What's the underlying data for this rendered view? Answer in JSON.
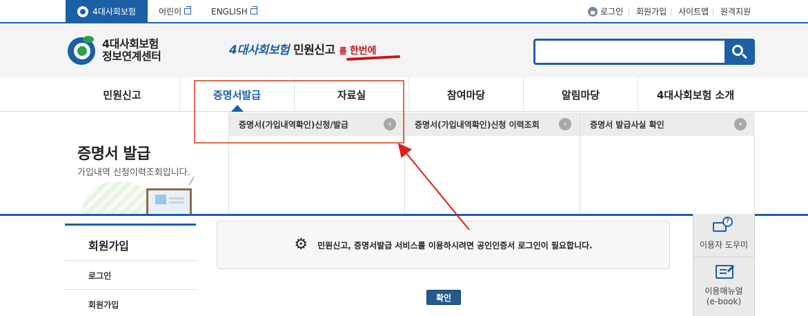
{
  "topbar": {
    "brand": "4대사회보험",
    "links": [
      "어린이",
      "ENGLISH"
    ],
    "util": [
      "로그인",
      "회원가입",
      "사이트맵",
      "원격지원"
    ]
  },
  "header": {
    "logo_line1": "4대사회보험",
    "logo_line2": "정보연계센터",
    "slogan_a": "4대사회보험",
    "slogan_b": "민원신고",
    "slogan_c1": "를 ",
    "slogan_c2": "한번에",
    "search_placeholder": ""
  },
  "gnb": [
    "민원신고",
    "증명서발급",
    "자료실",
    "참여마당",
    "알림마당",
    "4대사회보험 소개"
  ],
  "submenu": [
    "증명서(가입내역확인)신청/발급",
    "증명서(가입내역확인)신청 이력조회",
    "증명서 발급사실 확인"
  ],
  "visual": {
    "title": "증명서 발급",
    "desc": "가입내역 신청이력조회입니다."
  },
  "lnb": {
    "title": "회원가입",
    "items": [
      "로그인",
      "회원가입"
    ]
  },
  "notice": {
    "text": "민원신고, 증명서발급 서비스를 이용하시려면 공인인증서 로그인이 필요합니다."
  },
  "confirm_label": "확인",
  "quick": {
    "help": "이용자 도우미",
    "manual_1": "이용매뉴얼",
    "manual_2": "(e-book)"
  },
  "colors": {
    "primary": "#1b5fa6",
    "annotation": "#d86a4e",
    "arrow": "#e01e1e"
  }
}
